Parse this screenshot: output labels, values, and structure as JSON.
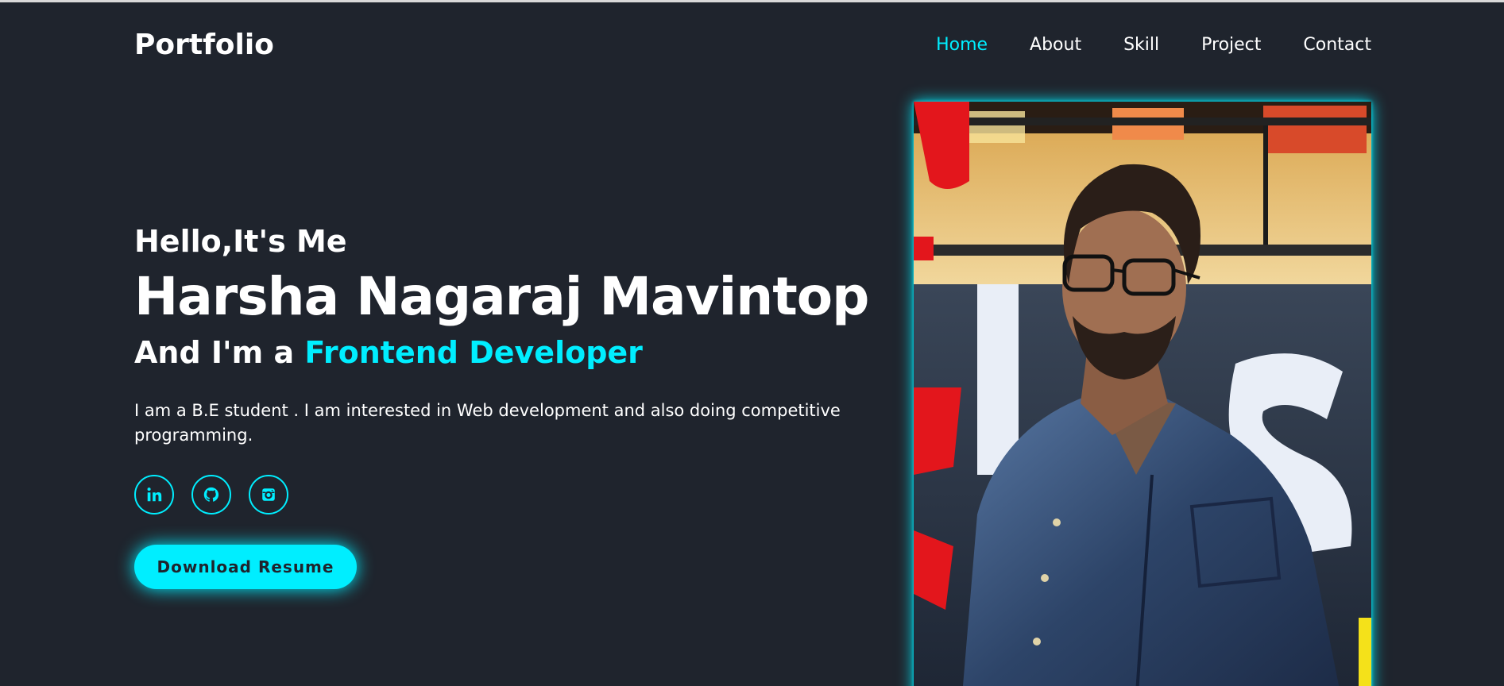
{
  "header": {
    "logo": "Portfolio",
    "nav": [
      {
        "label": "Home",
        "active": true
      },
      {
        "label": "About"
      },
      {
        "label": "Skill"
      },
      {
        "label": "Project"
      },
      {
        "label": "Contact"
      }
    ]
  },
  "hero": {
    "greeting": "Hello,It's Me",
    "name": "Harsha Nagaraj Mavintop",
    "role_prefix": "And I'm a",
    "role_highlight": "Frontend Developer",
    "description": "I am a B.E student . I am interested in Web development and also doing competitive programming.",
    "social": [
      {
        "icon": "linkedin-icon"
      },
      {
        "icon": "github-icon"
      },
      {
        "icon": "instagram-icon"
      }
    ],
    "button_label": "Download Resume"
  },
  "colors": {
    "background": "#1f242d",
    "accent": "#00eeff",
    "text": "#ffffff"
  }
}
